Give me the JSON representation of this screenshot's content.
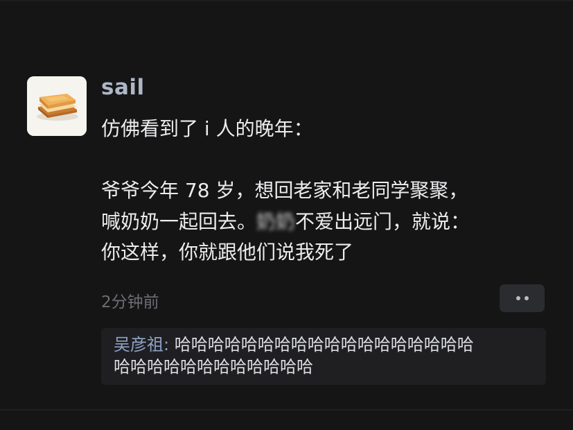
{
  "post": {
    "avatar_icon": "toast-sandwich-icon",
    "username": "sail",
    "content": {
      "line1": "仿佛看到了 i 人的晚年：",
      "line2": "爷爷今年 78 岁，想回老家和老同学聚聚，",
      "line3_pre": "喊奶奶一起回去。",
      "line3_blurred": "奶奶",
      "line3_post": "不爱出远门，就说：",
      "line4": "你这样，你就跟他们说我死了"
    },
    "timestamp": "2分钟前",
    "more_icon": "more-dots-icon"
  },
  "reply": {
    "author": "吴彦祖",
    "separator": ": ",
    "line1": "哈哈哈哈哈哈哈哈哈哈哈哈哈哈哈哈哈哈",
    "line2": "哈哈哈哈哈哈哈哈哈哈哈哈"
  },
  "colors": {
    "background": "#151516",
    "username": "#aeb7c6",
    "reply_author": "#8fa2c4",
    "timestamp": "#6c6e73"
  }
}
